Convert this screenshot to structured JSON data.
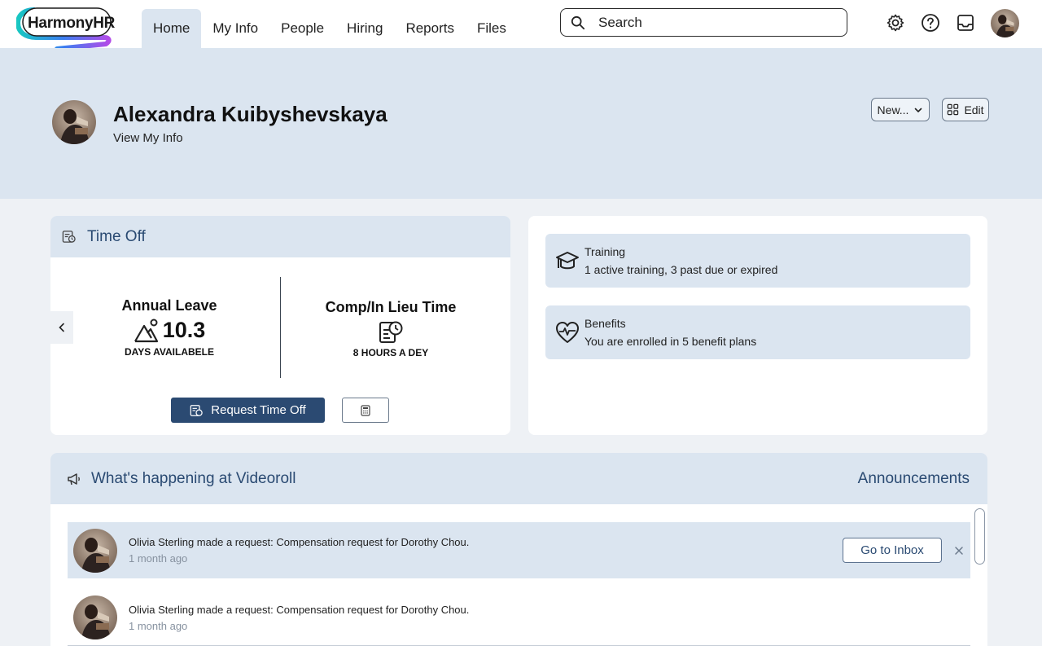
{
  "brand": {
    "name": "HarmonyHR"
  },
  "nav": {
    "items": [
      {
        "label": "Home"
      },
      {
        "label": "My Info"
      },
      {
        "label": "People"
      },
      {
        "label": "Hiring"
      },
      {
        "label": "Reports"
      },
      {
        "label": "Files"
      }
    ],
    "active": "Home"
  },
  "search": {
    "placeholder": "Search"
  },
  "profile": {
    "name": "Alexandra Kuibyshevskaya",
    "link": "View My Info",
    "new_label": "New...",
    "edit_label": "Edit"
  },
  "time_off": {
    "title": "Time Off",
    "annual": {
      "label": "Annual Leave",
      "value": "10.3",
      "unit": "DAYS AVAILABELE"
    },
    "comp": {
      "label": "Comp/In Lieu Time",
      "unit": "8 HOURS A DEY"
    },
    "request_label": "Request Time Off"
  },
  "summary": {
    "training": {
      "title": "Training",
      "text": "1 active training, 3 past due or expired"
    },
    "benefits": {
      "title": "Benefits",
      "text": "You are enrolled in 5 benefit plans"
    }
  },
  "happening": {
    "title": "What's happening at Videoroll",
    "link": "Announcements",
    "items": [
      {
        "message": "Olivia Sterling made a request: Compensation request for Dorothy Chou.",
        "time": "1 month ago",
        "action": "Go to Inbox"
      },
      {
        "message": "Olivia Sterling made a request: Compensation request for Dorothy Chou.",
        "time": "1 month ago"
      }
    ]
  },
  "colors": {
    "accent": "#2b4a72",
    "band": "#dbe5f0",
    "page": "#eef1f5"
  }
}
